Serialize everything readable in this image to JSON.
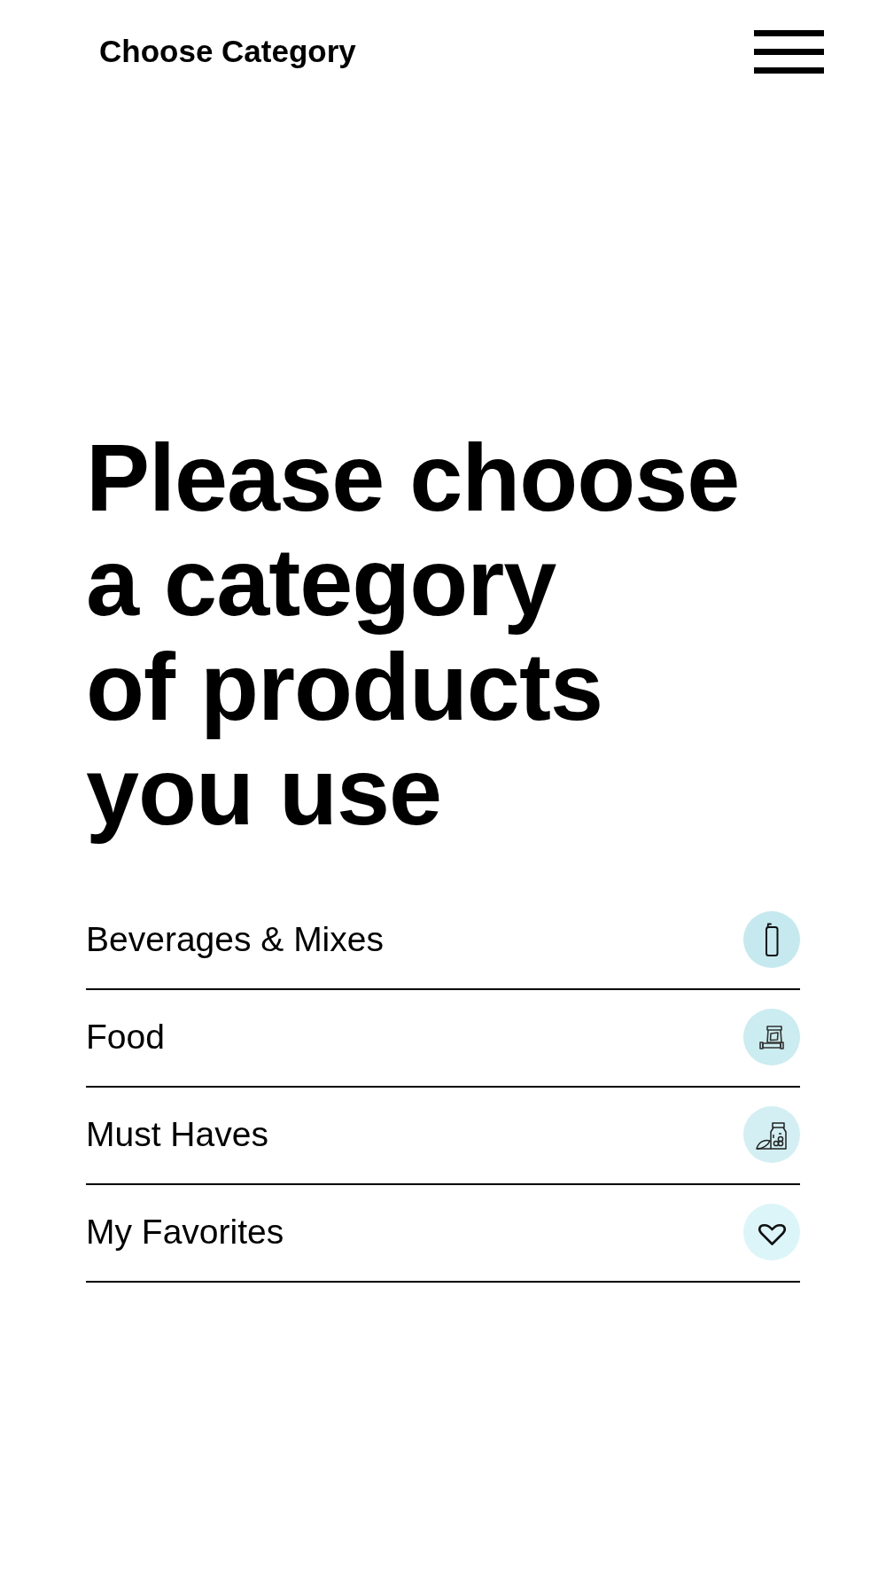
{
  "header": {
    "title": "Choose Category"
  },
  "heading": {
    "lines": [
      "Please choose",
      "a category",
      "of products",
      "you use"
    ]
  },
  "categories": [
    {
      "label": "Beverages & Mixes",
      "color": "#c5e9ee"
    },
    {
      "label": "Food",
      "color": "#cbecf0"
    },
    {
      "label": "Must Haves",
      "color": "#d3eff3"
    },
    {
      "label": "My Favorites",
      "color": "#dcf5f9"
    }
  ]
}
